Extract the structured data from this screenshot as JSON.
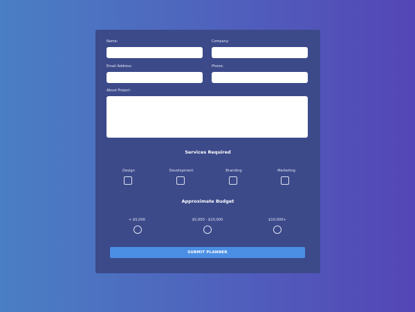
{
  "form": {
    "name_label": "Name:",
    "company_label": "Company:",
    "email_label": "Email Address:",
    "phone_label": "Phone:",
    "about_label": "About Project:",
    "name_value": "",
    "company_value": "",
    "email_value": "",
    "phone_value": "",
    "about_value": ""
  },
  "services": {
    "title": "Services Required",
    "options": [
      "Design",
      "Development",
      "Branding",
      "Marketing"
    ]
  },
  "budget": {
    "title": "Approximate Budget",
    "options": [
      "< $5,000",
      "$5,000 - $10,000",
      "$10,000+"
    ]
  },
  "submit_label": "SUBMIT PLANNER",
  "colors": {
    "card": "#3c4a8a",
    "button": "#4a8fe4",
    "bg_left": "#4a7fc4",
    "bg_right": "#5446b6"
  }
}
